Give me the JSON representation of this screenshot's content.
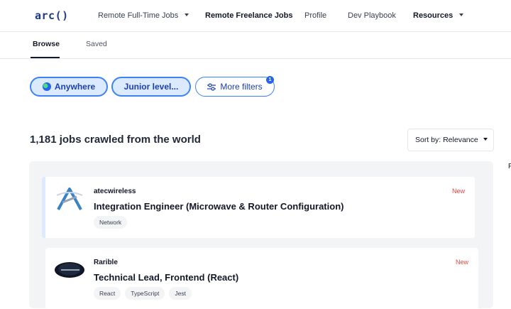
{
  "brand": {
    "logo_text": "arc()"
  },
  "topnav": {
    "items": [
      {
        "label": "Remote Full-Time Jobs",
        "dropdown": true
      },
      {
        "label": "Remote Freelance Jobs",
        "dropdown": false
      },
      {
        "label": "Profile",
        "dropdown": false
      },
      {
        "label": "Dev Playbook",
        "dropdown": false
      },
      {
        "label": "Resources",
        "dropdown": true
      }
    ]
  },
  "subnav": {
    "tabs": [
      {
        "label": "Browse",
        "active": true
      },
      {
        "label": "Saved",
        "active": false
      }
    ]
  },
  "filters": {
    "location": {
      "label": "Anywhere",
      "icon": "globe-icon"
    },
    "level": {
      "label": "Junior level..."
    },
    "more": {
      "label": "More filters",
      "icon": "sliders-icon",
      "badge_count": "1"
    }
  },
  "results": {
    "heading": "1,181 jobs crawled from the world",
    "sort_label": "Sort by: Relevance"
  },
  "jobs": [
    {
      "company": "atecwireless",
      "title": "Integration Engineer (Microwave & Router Configuration)",
      "status": "New",
      "tags": [
        "Network"
      ]
    },
    {
      "company": "Rarible",
      "title": "Technical Lead, Frontend (React)",
      "status": "New",
      "tags": [
        "React",
        "TypeScript",
        "Jest"
      ]
    }
  ],
  "sidebar_edge_text": "F",
  "colors": {
    "accent": "#3b82f6",
    "brand": "#1e3a8a",
    "new_tag": "#ef4444",
    "pill_fill": "#dbeafe"
  }
}
